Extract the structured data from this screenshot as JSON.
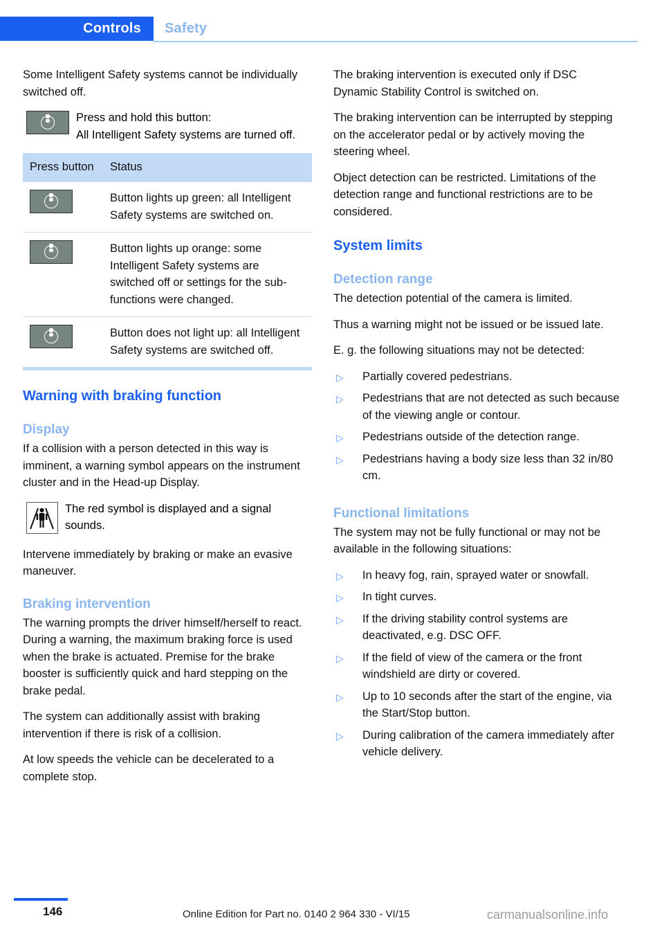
{
  "header": {
    "active_tab": "Controls",
    "inactive_tab": "Safety"
  },
  "left_column": {
    "intro_paragraph": "Some Intelligent Safety systems cannot be individually switched off.",
    "press_hold_line1": "Press and hold this button:",
    "press_hold_line2": "All Intelligent Safety systems are turned off.",
    "table": {
      "headers": {
        "col1": "Press button",
        "col2": "Status"
      },
      "rows": [
        {
          "icon": "intelligent-safety-button-icon",
          "status": "Button lights up green: all Intelligent Safety systems are switched on."
        },
        {
          "icon": "intelligent-safety-button-icon",
          "status": "Button lights up orange: some Intelligent Safety systems are switched off or settings for the sub-functions were changed."
        },
        {
          "icon": "intelligent-safety-button-icon",
          "status": "Button does not light up: all Intelligent Safety systems are switched off."
        }
      ]
    },
    "heading_warning": "Warning with braking function",
    "heading_display": "Display",
    "display_paragraph": "If a collision with a person detected in this way is imminent, a warning symbol appears on the instrument cluster and in the Head-up Display.",
    "symbol_note": "The red symbol is displayed and a signal sounds.",
    "intervene_paragraph": "Intervene immediately by braking or make an evasive maneuver.",
    "heading_braking": "Braking intervention",
    "braking_p1": "The warning prompts the driver himself/herself to react. During a warning, the maximum braking force is used when the brake is actuated. Premise for the brake booster is sufficiently quick and hard stepping on the brake pedal.",
    "braking_p2": "The system can additionally assist with braking intervention if there is risk of a collision.",
    "braking_p3": "At low speeds the vehicle can be decelerated to a complete stop."
  },
  "right_column": {
    "p1": "The braking intervention is executed only if DSC Dynamic Stability Control is switched on.",
    "p2": "The braking intervention can be interrupted by stepping on the accelerator pedal or by actively moving the steering wheel.",
    "p3": "Object detection can be restricted. Limitations of the detection range and functional restrictions are to be considered.",
    "heading_system_limits": "System limits",
    "heading_detection_range": "Detection range",
    "detection_p1": "The detection potential of the camera is limited.",
    "detection_p2": "Thus a warning might not be issued or be issued late.",
    "detection_p3": "E. g. the following situations may not be detected:",
    "detection_bullets": [
      "Partially covered pedestrians.",
      "Pedestrians that are not detected as such because of the viewing angle or contour.",
      "Pedestrians outside of the detection range.",
      "Pedestrians having a body size less than 32 in/80 cm."
    ],
    "heading_functional_limitations": "Functional limitations",
    "functional_intro": "The system may not be fully functional or may not be available in the following situations:",
    "functional_bullets": [
      "In heavy fog, rain, sprayed water or snowfall.",
      "In tight curves.",
      "If the driving stability control systems are deactivated, e.g. DSC OFF.",
      "If the field of view of the camera or the front windshield are dirty or covered.",
      "Up to 10 seconds after the start of the engine, via the Start/Stop button.",
      "During calibration of the camera immediately after vehicle delivery."
    ]
  },
  "footer": {
    "page_number": "146",
    "edition_text": "Online Edition for Part no. 0140 2 964 330 - VI/15",
    "watermark": "carmanualsonline.info"
  },
  "colors": {
    "accent_blue": "#1a5ff0",
    "light_blue": "#8ab6ef",
    "table_header_bg": "#c2daf6",
    "button_gray": "#768582",
    "bullet_blue": "#5b9bf0"
  },
  "bullet_marker": "▷"
}
